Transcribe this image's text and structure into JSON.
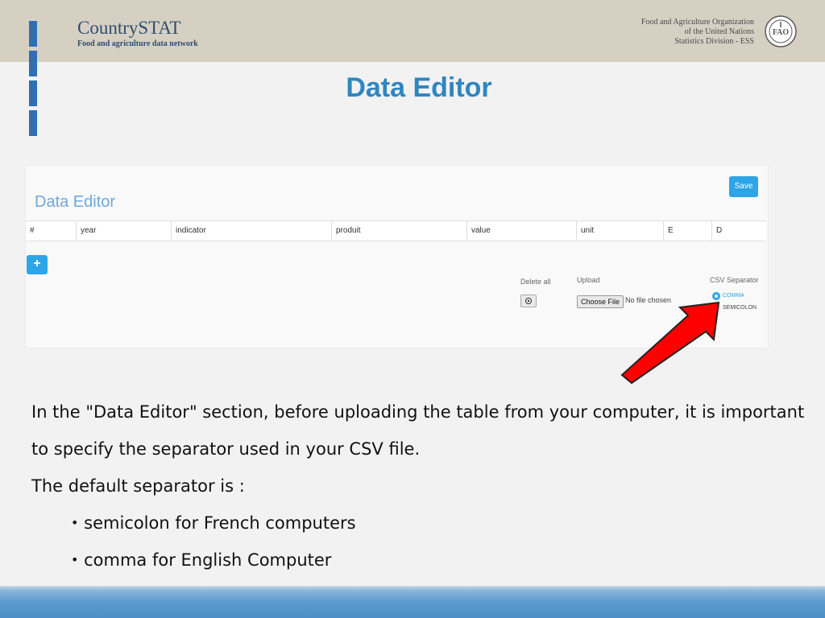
{
  "header": {
    "logo_title": "CountrySTAT",
    "logo_subtitle": "Food and agriculture data network",
    "org_line1": "Food and Agriculture Organization",
    "org_line2": "of the United Nations",
    "org_line3": "Statistics Division - ESS",
    "emblem_icon": "fao-emblem-icon"
  },
  "page_title": "Data Editor",
  "editor": {
    "heading": "Data Editor",
    "save_label": "Save",
    "columns": [
      "#",
      "year",
      "indicator",
      "produit",
      "value",
      "unit",
      "E",
      "D"
    ],
    "add_label": "+",
    "delete_all_label": "Delete all",
    "upload_label": "Upload",
    "choose_file_label": "Choose File",
    "no_file_text": "No file chosen",
    "csv_separator_label": "CSV Separator",
    "separator_options": [
      {
        "label": "COMMA",
        "selected": true
      },
      {
        "label": "SEMICOLON",
        "selected": false
      }
    ]
  },
  "body": {
    "line1": "In the \"Data Editor\" section, before uploading the table from your computer, it is important",
    "line2": "to specify the separator used in your CSV file.",
    "line3": "The default separator is :",
    "bullets": [
      "semicolon for French computers",
      "comma for English Computer"
    ],
    "bullet_char": "•"
  },
  "colors": {
    "accent": "#2e86c1",
    "button": "#2fa4e7",
    "header_bg": "#d6d0c3",
    "arrow": "#ff0000"
  }
}
